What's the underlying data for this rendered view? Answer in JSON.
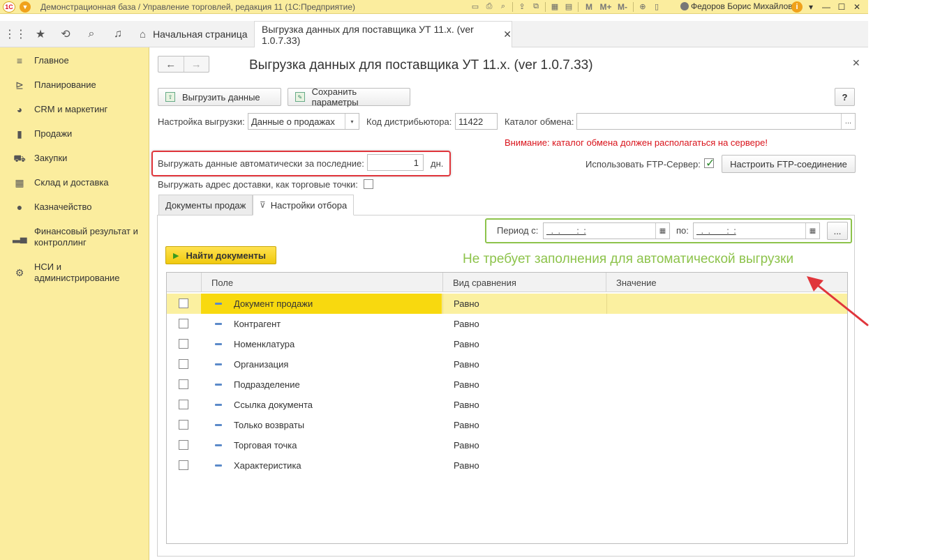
{
  "window": {
    "title": "Демонстрационная база / Управление торговлей, редакция 11  (1С:Предприятие)",
    "logo_text": "1С",
    "user": "Федоров Борис Михайлович",
    "toolbar_m_labels": [
      "M",
      "M+",
      "M-"
    ]
  },
  "tabs": {
    "home_label": "Начальная страница",
    "active_label": "Выгрузка данных для поставщика УТ 11.х. (ver 1.0.7.33)"
  },
  "sidebar": {
    "items": [
      {
        "label": "Главное",
        "icon": "menu-icon"
      },
      {
        "label": "Планирование",
        "icon": "planning-icon"
      },
      {
        "label": "CRM и маркетинг",
        "icon": "crm-icon"
      },
      {
        "label": "Продажи",
        "icon": "sales-icon"
      },
      {
        "label": "Закупки",
        "icon": "cart-icon"
      },
      {
        "label": "Склад и доставка",
        "icon": "warehouse-icon"
      },
      {
        "label": "Казначейство",
        "icon": "treasury-icon"
      },
      {
        "label": "Финансовый результат и контроллинг",
        "icon": "chart-icon"
      },
      {
        "label": "НСИ и администрирование",
        "icon": "gear-icon"
      }
    ]
  },
  "form": {
    "title": "Выгрузка данных для поставщика УТ 11.х. (ver 1.0.7.33)",
    "export_button": "Выгрузить данные",
    "save_button": "Сохранить параметры",
    "help_button": "?",
    "setting_label": "Настройка выгрузки:",
    "setting_value": "Данные о продажах",
    "distributor_label": "Код дистрибьютора:",
    "distributor_value": "11422",
    "catalog_label": "Каталог обмена:",
    "catalog_value": "",
    "catalog_btn": "...",
    "warning": "Внимание: каталог обмена должен располагаться на сервере!",
    "auto_label": "Выгружать данные автоматически за последние:",
    "auto_value": "1",
    "auto_unit": "дн.",
    "ftp_label": "Использовать FTP-Сервер:",
    "ftp_checked": true,
    "ftp_button": "Настроить FTP-соединение",
    "address_label": "Выгружать адрес доставки, как торговые точки:",
    "address_checked": false
  },
  "inner_tabs": {
    "tab1": "Документы продаж",
    "tab2": "Настройки отбора"
  },
  "filter": {
    "period_from_label": "Период с:",
    "period_from_value": "  .  .       :  :",
    "period_to_label": "по:",
    "period_to_value": "  .  .       :  :",
    "period_btn": "...",
    "find_button": "Найти документы",
    "annotation": "Не требует заполнения для автоматической выгрузки"
  },
  "grid": {
    "columns": [
      "Поле",
      "Вид сравнения",
      "Значение"
    ],
    "rows": [
      {
        "field": "Документ продажи",
        "comparison": "Равно",
        "value": ""
      },
      {
        "field": "Контрагент",
        "comparison": "Равно",
        "value": ""
      },
      {
        "field": "Номенклатура",
        "comparison": "Равно",
        "value": ""
      },
      {
        "field": "Организация",
        "comparison": "Равно",
        "value": ""
      },
      {
        "field": "Подразделение",
        "comparison": "Равно",
        "value": ""
      },
      {
        "field": "Ссылка документа",
        "comparison": "Равно",
        "value": ""
      },
      {
        "field": "Только возвраты",
        "comparison": "Равно",
        "value": ""
      },
      {
        "field": "Торговая точка",
        "comparison": "Равно",
        "value": ""
      },
      {
        "field": "Характеристика",
        "comparison": "Равно",
        "value": ""
      }
    ]
  },
  "colors": {
    "accent_yellow": "#fbed9e",
    "highlight_red": "#e0353b",
    "highlight_green": "#8dc34b",
    "warning_red": "#d9121a"
  }
}
